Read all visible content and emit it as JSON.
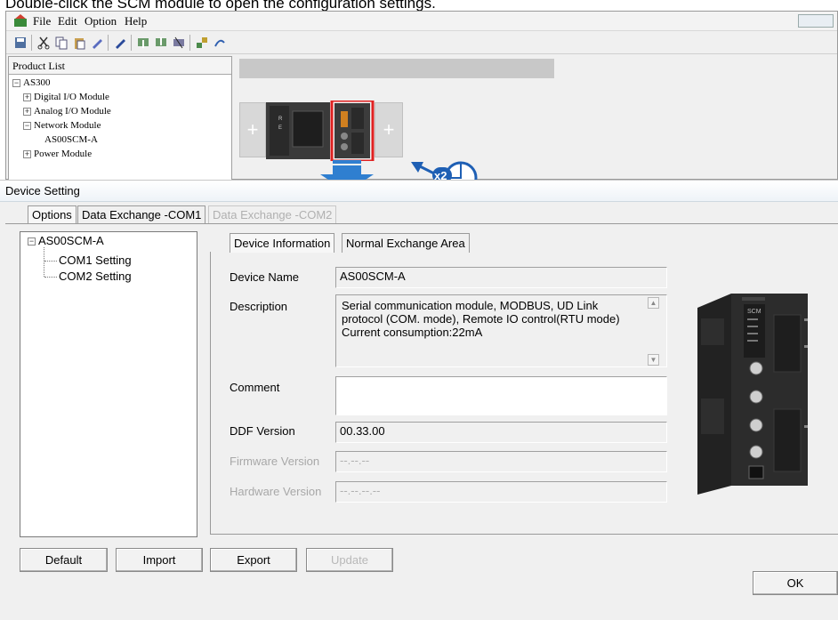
{
  "caption": "Double-click the SCM module to open the configuration settings.",
  "app": {
    "menu": [
      "File",
      "Edit",
      "Option",
      "Help"
    ],
    "product_list": {
      "header": "Product List",
      "root": "AS300",
      "items": [
        "Digital I/O Module",
        "Analog I/O Module",
        "Network Module",
        "Power Module"
      ],
      "child": "AS00SCM-A"
    },
    "callout_label": "x2"
  },
  "dialog": {
    "title": "Device Setting",
    "tabs": [
      "Options",
      "Data Exchange -COM1",
      "Data Exchange -COM2"
    ],
    "tree": {
      "root": "AS00SCM-A",
      "children": [
        "COM1 Setting",
        "COM2 Setting"
      ]
    },
    "inner_tabs": [
      "Device Information",
      "Normal Exchange Area"
    ],
    "fields": {
      "device_name_label": "Device Name",
      "device_name": "AS00SCM-A",
      "description_label": "Description",
      "description_lines": [
        "Serial communication module, MODBUS, UD Link",
        "protocol (COM. mode), Remote IO control(RTU mode)",
        "Current consumption:22mA"
      ],
      "comment_label": "Comment",
      "comment": "",
      "ddf_label": "DDF Version",
      "ddf": "00.33.00",
      "firmware_label": "Firmware Version",
      "firmware": "--.--.--",
      "hardware_label": "Hardware Version",
      "hardware": "--.--.--.--"
    },
    "module_label": "SCM",
    "buttons": {
      "default": "Default",
      "import": "Import",
      "export": "Export",
      "update": "Update",
      "ok": "OK"
    }
  },
  "colors": {
    "arrow": "#2f7fd0",
    "highlight": "#e02020",
    "callout": "#1e5fb4"
  }
}
